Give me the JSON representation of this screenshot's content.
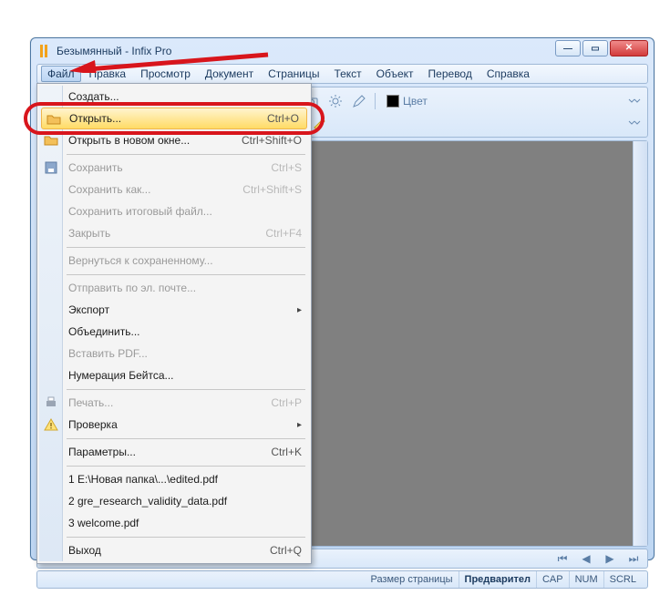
{
  "window": {
    "title": "Безымянный - Infix Pro"
  },
  "menubar": [
    "Файл",
    "Правка",
    "Просмотр",
    "Документ",
    "Страницы",
    "Текст",
    "Объект",
    "Перевод",
    "Справка"
  ],
  "color_label": "Цвет",
  "file_menu": {
    "items": [
      {
        "label": "Создать...",
        "shortcut": "",
        "icon": "",
        "disabled": false
      },
      {
        "label": "Открыть...",
        "shortcut": "Ctrl+O",
        "icon": "folder",
        "disabled": false,
        "highlight": true
      },
      {
        "label": "Открыть в новом окне...",
        "shortcut": "Ctrl+Shift+O",
        "icon": "folder",
        "disabled": false
      },
      {
        "sep": true
      },
      {
        "label": "Сохранить",
        "shortcut": "Ctrl+S",
        "icon": "save",
        "disabled": true
      },
      {
        "label": "Сохранить как...",
        "shortcut": "Ctrl+Shift+S",
        "icon": "",
        "disabled": true
      },
      {
        "label": "Сохранить итоговый файл...",
        "shortcut": "",
        "disabled": true
      },
      {
        "label": "Закрыть",
        "shortcut": "Ctrl+F4",
        "disabled": true
      },
      {
        "sep": true
      },
      {
        "label": "Вернуться к сохраненному...",
        "disabled": true
      },
      {
        "sep": true
      },
      {
        "label": "Отправить по эл. почте...",
        "disabled": true
      },
      {
        "label": "Экспорт",
        "submenu": true,
        "disabled": false
      },
      {
        "label": "Объединить...",
        "disabled": false
      },
      {
        "label": "Вставить PDF...",
        "disabled": true
      },
      {
        "label": "Нумерация Бейтса...",
        "disabled": false
      },
      {
        "sep": true
      },
      {
        "label": "Печать...",
        "shortcut": "Ctrl+P",
        "icon": "print",
        "disabled": true
      },
      {
        "label": "Проверка",
        "submenu": true,
        "icon": "warn",
        "disabled": false
      },
      {
        "sep": true
      },
      {
        "label": "Параметры...",
        "shortcut": "Ctrl+K",
        "disabled": false
      },
      {
        "sep": true
      },
      {
        "label": "1 E:\\Новая папка\\...\\edited.pdf",
        "disabled": false
      },
      {
        "label": "2 gre_research_validity_data.pdf",
        "disabled": false
      },
      {
        "label": "3 welcome.pdf",
        "disabled": false
      },
      {
        "sep": true
      },
      {
        "label": "Выход",
        "shortcut": "Ctrl+Q",
        "disabled": false
      }
    ]
  },
  "status": {
    "page_size": "Размер страницы",
    "preview": "Предварител",
    "cap": "CAP",
    "num": "NUM",
    "scrl": "SCRL"
  }
}
